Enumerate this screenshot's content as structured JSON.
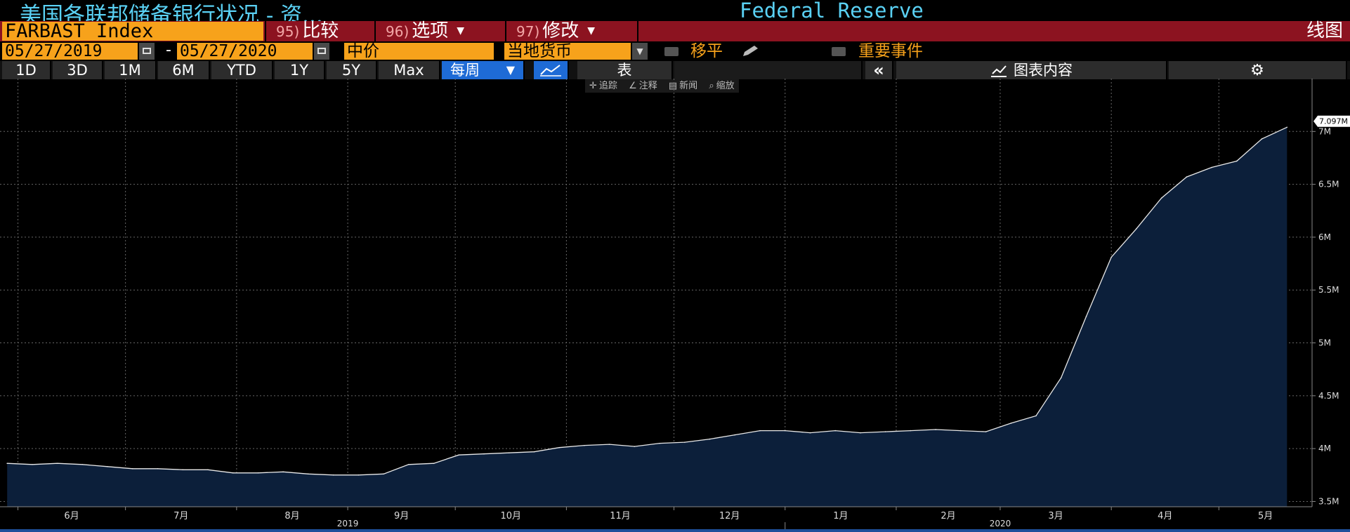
{
  "header": {
    "title_left": "美国各联邦储备银行状况 - 资...",
    "title_right": "Federal Reserve"
  },
  "toolbar": {
    "ticker": "FARBAST Index",
    "compare_num": "95)",
    "compare_label": "比较",
    "options_num": "96)",
    "options_label": "选项",
    "edit_num": "97)",
    "edit_label": "修改",
    "chart_type": "线图"
  },
  "dates": {
    "start": "05/27/2019",
    "separator": "-",
    "end": "05/27/2020",
    "price_field": "中价",
    "currency": "当地货币",
    "smooth_label": "移平",
    "events_label": "重要事件"
  },
  "ranges": {
    "items": [
      "1D",
      "3D",
      "1M",
      "6M",
      "YTD",
      "1Y",
      "5Y",
      "Max"
    ],
    "frequency": "每周",
    "table_label": "表",
    "collapse": "«",
    "chart_content": "图表内容"
  },
  "hints": {
    "track": "追踪",
    "annotate": "注释",
    "news": "新闻",
    "zoom": "缩放"
  },
  "colors": {
    "accent_orange": "#f7a21b",
    "title_cyan": "#5ad1f4",
    "menu_red": "#8c1320",
    "area_fill": "#0c1f3a",
    "selected_blue": "#1e6bd6"
  },
  "icons": [
    "calendar-icon",
    "dropdown-arrow-icon",
    "pencil-icon",
    "line-chart-icon",
    "collapse-icon",
    "chart-content-icon",
    "gear-icon",
    "crosshair-icon",
    "annotate-icon",
    "news-icon",
    "zoom-icon"
  ],
  "chart_data": {
    "type": "area",
    "x": [
      "2019-05-29",
      "2019-06-05",
      "2019-06-12",
      "2019-06-19",
      "2019-06-26",
      "2019-07-03",
      "2019-07-10",
      "2019-07-17",
      "2019-07-24",
      "2019-07-31",
      "2019-08-07",
      "2019-08-14",
      "2019-08-21",
      "2019-08-28",
      "2019-09-04",
      "2019-09-11",
      "2019-09-18",
      "2019-09-25",
      "2019-10-02",
      "2019-10-09",
      "2019-10-16",
      "2019-10-23",
      "2019-10-30",
      "2019-11-06",
      "2019-11-13",
      "2019-11-20",
      "2019-11-27",
      "2019-12-04",
      "2019-12-11",
      "2019-12-18",
      "2019-12-25",
      "2020-01-01",
      "2020-01-08",
      "2020-01-15",
      "2020-01-22",
      "2020-01-29",
      "2020-02-05",
      "2020-02-12",
      "2020-02-19",
      "2020-02-26",
      "2020-03-04",
      "2020-03-11",
      "2020-03-18",
      "2020-03-25",
      "2020-04-01",
      "2020-04-08",
      "2020-04-15",
      "2020-04-22",
      "2020-04-29",
      "2020-05-06",
      "2020-05-13",
      "2020-05-20"
    ],
    "values": [
      3.86,
      3.85,
      3.86,
      3.85,
      3.83,
      3.81,
      3.81,
      3.8,
      3.8,
      3.77,
      3.77,
      3.78,
      3.76,
      3.75,
      3.75,
      3.76,
      3.85,
      3.86,
      3.94,
      3.95,
      3.96,
      3.97,
      4.01,
      4.03,
      4.04,
      4.02,
      4.05,
      4.06,
      4.09,
      4.13,
      4.17,
      4.17,
      4.15,
      4.17,
      4.15,
      4.16,
      4.17,
      4.18,
      4.17,
      4.16,
      4.24,
      4.31,
      4.67,
      5.25,
      5.81,
      6.08,
      6.37,
      6.57,
      6.66,
      6.72,
      6.93,
      7.04
    ],
    "last_value": "7.097M",
    "last_value_num": 7.097,
    "unit": "M",
    "ylim": [
      3.45,
      7.5
    ],
    "yticks": [
      3.5,
      4,
      4.5,
      5,
      5.5,
      6,
      6.5,
      7
    ],
    "ytick_labels": [
      "3.5M",
      "4M",
      "4.5M",
      "5M",
      "5.5M",
      "6M",
      "6.5M",
      "7M"
    ],
    "month_ticks": [
      {
        "date": "2019-06-01",
        "label": "6月"
      },
      {
        "date": "2019-07-01",
        "label": "7月"
      },
      {
        "date": "2019-08-01",
        "label": "8月"
      },
      {
        "date": "2019-09-01",
        "label": "9月"
      },
      {
        "date": "2019-10-01",
        "label": "10月"
      },
      {
        "date": "2019-11-01",
        "label": "11月"
      },
      {
        "date": "2019-12-01",
        "label": "12月"
      },
      {
        "date": "2020-01-01",
        "label": "1月"
      },
      {
        "date": "2020-02-01",
        "label": "2月"
      },
      {
        "date": "2020-03-01",
        "label": "3月"
      },
      {
        "date": "2020-04-01",
        "label": "4月"
      },
      {
        "date": "2020-05-01",
        "label": "5月"
      }
    ],
    "year_labels": [
      {
        "date": "2019-09-01",
        "label": "2019"
      },
      {
        "date": "2020-03-01",
        "label": "2020"
      }
    ],
    "x_range": [
      "2019-05-27",
      "2020-05-27"
    ],
    "grid": true
  }
}
